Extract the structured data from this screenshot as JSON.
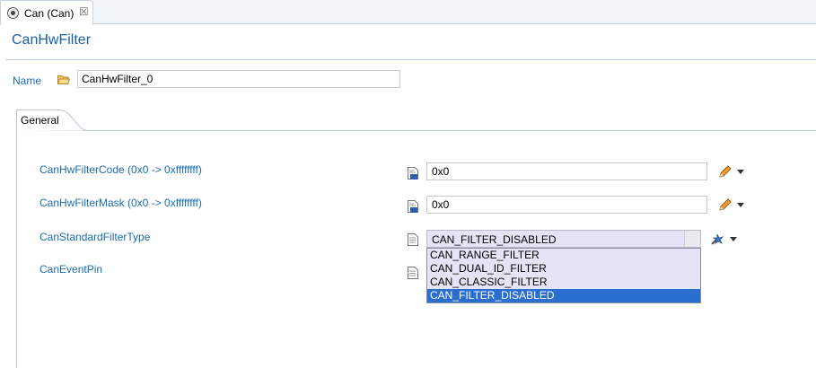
{
  "editor_tab": {
    "title": "Can (Can)",
    "close": "☒"
  },
  "page_title": "CanHwFilter",
  "name_field": {
    "label": "Name",
    "value": "CanHwFilter_0"
  },
  "section_tab": {
    "label": "General"
  },
  "params": {
    "filter_code": {
      "label": "CanHwFilterCode (0x0 -> 0xffffffff)",
      "value": "0x0"
    },
    "filter_mask": {
      "label": "CanHwFilterMask (0x0 -> 0xffffffff)",
      "value": "0x0"
    },
    "standard_filter_type": {
      "label": "CanStandardFilterType",
      "value": "CAN_FILTER_DISABLED"
    },
    "event_pin": {
      "label": "CanEventPin"
    }
  },
  "dropdown": {
    "options": [
      "CAN_RANGE_FILTER",
      "CAN_DUAL_ID_FILTER",
      "CAN_CLASSIC_FILTER",
      "CAN_FILTER_DISABLED"
    ],
    "selected_index": 3
  },
  "icons": {
    "tab": "config-icon",
    "folder": "folder-open-icon",
    "hex_doc": "hex-document-icon",
    "doc": "document-icon",
    "pencil": "pencil-icon",
    "wand": "wand-icon",
    "arrow": "chevron-down-icon"
  },
  "colors": {
    "label_blue": "#1a6bb4",
    "title_blue": "#1a5fa3",
    "selection": "#2a6fd0",
    "list_bg": "#e4e4f6"
  }
}
